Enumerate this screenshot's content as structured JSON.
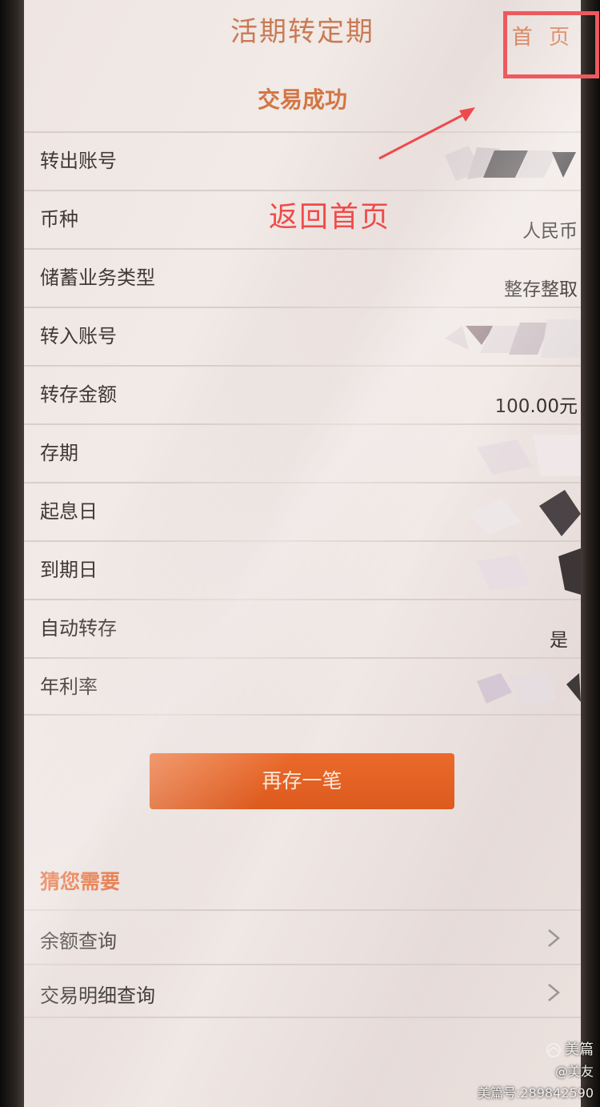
{
  "header": {
    "title": "活期转定期",
    "home_label": "首 页"
  },
  "annotation": {
    "text": "返回首页",
    "color": "#ec5a5e"
  },
  "status": {
    "success_text": "交易成功"
  },
  "details": [
    {
      "label": "转出账号",
      "value": ""
    },
    {
      "label": "币种",
      "value": "人民币"
    },
    {
      "label": "储蓄业务类型",
      "value": "整存整取"
    },
    {
      "label": "转入账号",
      "value": ""
    },
    {
      "label": "转存金额",
      "value": "100.00元"
    },
    {
      "label": "存期",
      "value": ""
    },
    {
      "label": "起息日",
      "value": ""
    },
    {
      "label": "到期日",
      "value": ""
    },
    {
      "label": "自动转存",
      "value": "是"
    },
    {
      "label": "年利率",
      "value": ""
    }
  ],
  "primary_button": {
    "label": "再存一笔",
    "color": "#e5642a"
  },
  "suggestions": {
    "title": "猜您需要",
    "items": [
      {
        "label": "余额查询"
      },
      {
        "label": "交易明细查询"
      }
    ]
  },
  "watermark": {
    "brand": "美篇",
    "user": "@美友",
    "id": "美篇号:289842590"
  },
  "icons": {
    "chevron": "chevron-right-icon",
    "brand": "meipian-logo-icon"
  }
}
